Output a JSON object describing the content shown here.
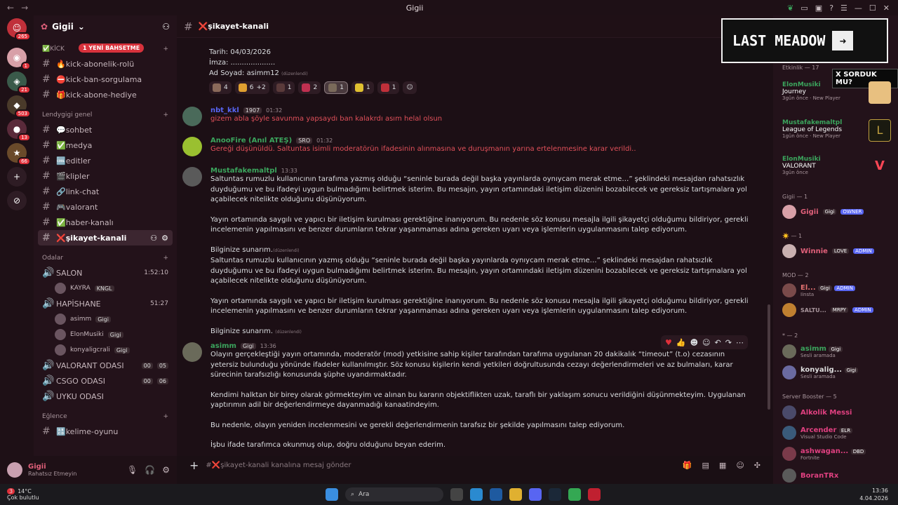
{
  "window": {
    "title": "Gigii"
  },
  "server": {
    "name": "Gigii",
    "new_messages": "1 YENİ BAHSETME"
  },
  "guild_badges": [
    "265",
    "1",
    "21",
    "503",
    "13",
    "66"
  ],
  "categories": {
    "kick": "✅KİCK",
    "genel": "Lendygigi genel",
    "odalar": "Odalar",
    "eglence": "Eğlence"
  },
  "channels_kick": [
    "🔥kick-abonelik-rolü",
    "⛔kick-ban-sorgulama",
    "🎁kick-abone-hediye"
  ],
  "channels_genel": [
    "💬sohbet",
    "✅medya",
    "🆒editler",
    "🎬klipler",
    "🔗link-chat",
    "🎮valorant",
    "✅haber-kanalı",
    "❌şikayet-kanali"
  ],
  "voice": {
    "salon": {
      "name": "SALON",
      "time": "1:52:10",
      "user": "KAYRA",
      "user_tag": "KNGL"
    },
    "hapishane": {
      "name": "HAPİSHANE",
      "time": "51:27",
      "users": [
        {
          "name": "asimm",
          "tag": "Gigi"
        },
        {
          "name": "ElonMusiki",
          "tag": "Gigi"
        },
        {
          "name": "konyaligcrali",
          "tag": "Gigi"
        }
      ]
    },
    "valorant": {
      "name": "VALORANT ODASI",
      "a": "00",
      "b": "05"
    },
    "csgo": {
      "name": "CSGO ODASI",
      "a": "00",
      "b": "06"
    },
    "uyku": {
      "name": "UYKU ODASI"
    },
    "kelime": "🔠kelime-oyunu"
  },
  "user_panel": {
    "name": "Gigii",
    "status": "Rahatsız Etmeyin"
  },
  "chat": {
    "channel_title": "❌şikayet-kanali",
    "top_lines": [
      "Tarih: 04/03/2026",
      "İmza: ....................",
      "Ad Soyad: asimm12"
    ],
    "edited": "(düzenlendi)",
    "reactions": [
      "4",
      "6",
      "+2",
      "1",
      "2",
      "1",
      "1",
      "1"
    ],
    "m1": {
      "name": "nbt_kkl",
      "tag": "1907",
      "time": "01:32",
      "text": "gizem abla şöyle savunma yapsaydı ban kalakrdı asım helal olsun"
    },
    "m2": {
      "name": "AnooFire (Anıl ATEŞ)",
      "tag": "SRO",
      "time": "01:32",
      "text": "Gereği düşünüldü. Saltuntas isimli moderatörün ifadesinin alınmasına ve duruşmanın yarına ertelenmesine karar verildi.."
    },
    "m3": {
      "name": "Mustafakemaltpl",
      "time": "13:33",
      "p1": "Saltuntas rumuzlu kullanıcının tarafıma yazmış olduğu “seninle burada değil başka yayınlarda oynıycam merak etme…” şeklindeki mesajdan rahatsızlık duyduğumu ve bu ifadeyi uygun bulmadığımı belirtmek isterim. Bu mesajın, yayın ortamındaki iletişim düzenini bozabilecek ve gereksiz tartışmalara yol açabilecek nitelikte olduğunu düşünüyorum.",
      "p2": "Yayın ortamında saygılı ve yapıcı bir iletişim kurulması gerektiğine inanıyorum. Bu nedenle söz konusu mesajla ilgili şikayetçi olduğumu bildiriyor, gerekli incelemenin yapılmasını ve benzer durumların tekrar yaşanmaması adına gereken uyarı veya işlemlerin uygulanmasını talep ediyorum.",
      "p3": "Bilginize sunarım.",
      "p4": "Saltuntas rumuzlu kullanıcının yazmış olduğu “seninle burada değil başka yayınlarda oynıycam merak etme…” şeklindeki mesajdan rahatsızlık duyduğumu ve bu ifadeyi uygun bulmadığımı belirtmek isterim. Bu mesajın, yayın ortamındaki iletişim düzenini bozabilecek ve gereksiz tartışmalara yol açabilecek nitelikte olduğunu düşünüyorum.",
      "p5": "Yayın ortamında saygılı ve yapıcı bir iletişim kurulması gerektiğine inanıyorum. Bu nedenle söz konusu mesajla ilgili şikayetçi olduğumu bildiriyor, gerekli incelemenin yapılmasını ve benzer durumların tekrar yaşanmaması adına gereken uyarı veya işlemlerin uygulanmasını talep ediyorum.",
      "p6": "Bilginize sunarım."
    },
    "m4": {
      "name": "asimm",
      "tag": "Gigi",
      "time": "13:36",
      "p1": "Olayın gerçekleştiği yayın ortamında, moderatör (mod) yetkisine sahip kişiler tarafından tarafıma uygulanan 20 dakikalık “timeout” (t.o) cezasının yetersiz bulunduğu yönünde ifadeler kullanılmıştır. Söz konusu kişilerin kendi yetkileri doğrultusunda cezayı değerlendirmeleri ve az bulmaları, karar sürecinin tarafsızlığı konusunda şüphe uyandırmaktadır.",
      "p2": "Kendimi halktan bir birey olarak görmekteyim ve alınan bu kararın objektiflikten uzak, taraflı bir yaklaşım sonucu verildiğini düşünmekteyim. Uygulanan yaptırımın adil bir değerlendirmeye dayanmadığı kanaatindeyim.",
      "p3": "Bu nedenle, olayın yeniden incelenmesini ve gerekli değerlendirmenin tarafsız bir şekilde yapılmasını talep ediyorum.",
      "p4": "İşbu ifade tarafımca okunmuş olup, doğru olduğunu beyan ederim."
    },
    "composer_placeholder": "#❌şikayet-kanali kanalına mesaj gönder"
  },
  "banner": {
    "text": "LAST MEADOW",
    "sorduk": "X SORDUK MU?"
  },
  "members": {
    "activity_header": "Etkinlik — 17",
    "activities": [
      {
        "user": "ElonMusiki",
        "game": "Journey",
        "meta": "3gün önce",
        "badge": "New Player"
      },
      {
        "user": "Mustafakemaltpl",
        "game": "League of Legends",
        "meta": "1gün önce",
        "badge": "New Player"
      },
      {
        "user": "ElonMusiki",
        "game": "VALORANT",
        "meta": "3gün önce",
        "badge": ""
      }
    ],
    "groups": {
      "gigii": "Gigii — 1",
      "star": "☀️ — 1",
      "mod": "MOD — 2",
      "asterisk": "* — 2",
      "booster": "Server Booster — 5"
    },
    "owner": {
      "name": "Gigii",
      "tag": "Gigi",
      "role": "OWNER"
    },
    "winnie": {
      "name": "Winnie",
      "tag": "LOVE",
      "role": "ADMIN"
    },
    "mod1": {
      "name": "El...",
      "tag": "Gigi",
      "role": "ADMIN",
      "sub": "Iinsta"
    },
    "mod2": {
      "name": "SALTU...",
      "tag": "MRPY",
      "role": "ADMIN"
    },
    "ast1": {
      "name": "asimm",
      "tag": "Gigi",
      "sub": "Sesli aramada"
    },
    "ast2": {
      "name": "konyalig...",
      "tag": "Gigi",
      "sub": "Sesli aramada"
    },
    "b1": {
      "name": "Alkolik Messi"
    },
    "b2": {
      "name": "Arcender",
      "tag": "ELR",
      "sub": "Visual Studio Code"
    },
    "b3": {
      "name": "ashwagan...",
      "tag": "DBD",
      "sub": "Fortnite"
    },
    "b4": {
      "name": "BoranTRx"
    }
  },
  "taskbar": {
    "temp": "14°C",
    "weather": "Çok bulutlu",
    "weather_badge": "3",
    "search": "Ara",
    "time": "13:36",
    "date": "4.04.2026"
  }
}
